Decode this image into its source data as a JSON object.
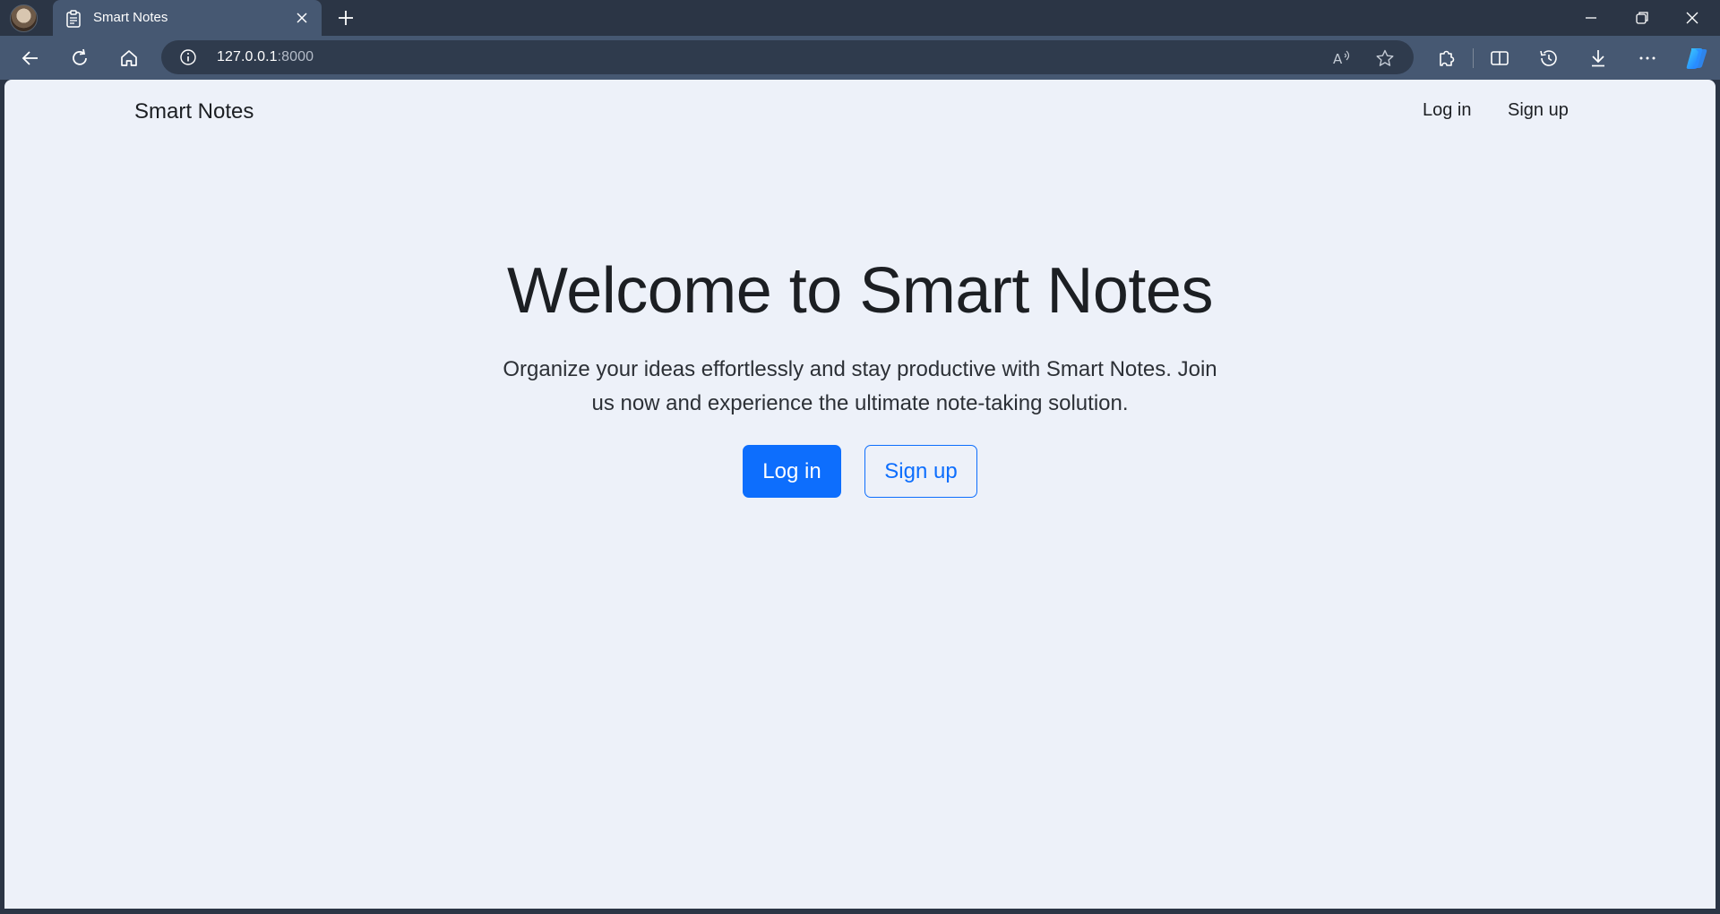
{
  "browser": {
    "tab": {
      "title": "Smart Notes",
      "icon": "clipboard-icon"
    },
    "address": {
      "host": "127.0.0.1",
      "port": ":8000"
    },
    "icons": {
      "back": "back-arrow-icon",
      "refresh": "refresh-icon",
      "home": "home-icon",
      "info": "info-icon",
      "read_aloud": "read-aloud-icon",
      "favorite": "star-icon",
      "extensions": "extensions-icon",
      "split_screen": "split-screen-icon",
      "history": "history-icon",
      "downloads": "download-icon",
      "more": "more-icon",
      "copilot": "copilot-icon"
    }
  },
  "navbar": {
    "brand": "Smart Notes",
    "links": [
      {
        "label": "Log in"
      },
      {
        "label": "Sign up"
      }
    ]
  },
  "hero": {
    "title": "Welcome to Smart Notes",
    "lead_line1": "Organize your ideas effortlessly and stay productive with Smart Notes. Join",
    "lead_line2": "us now and experience the ultimate note-taking solution.",
    "primary_button": "Log in",
    "secondary_button": "Sign up"
  },
  "colors": {
    "accent": "#0d6efd",
    "page_background": "#edf1f9",
    "chrome_background": "#2b3545",
    "toolbar_background": "#465872"
  }
}
